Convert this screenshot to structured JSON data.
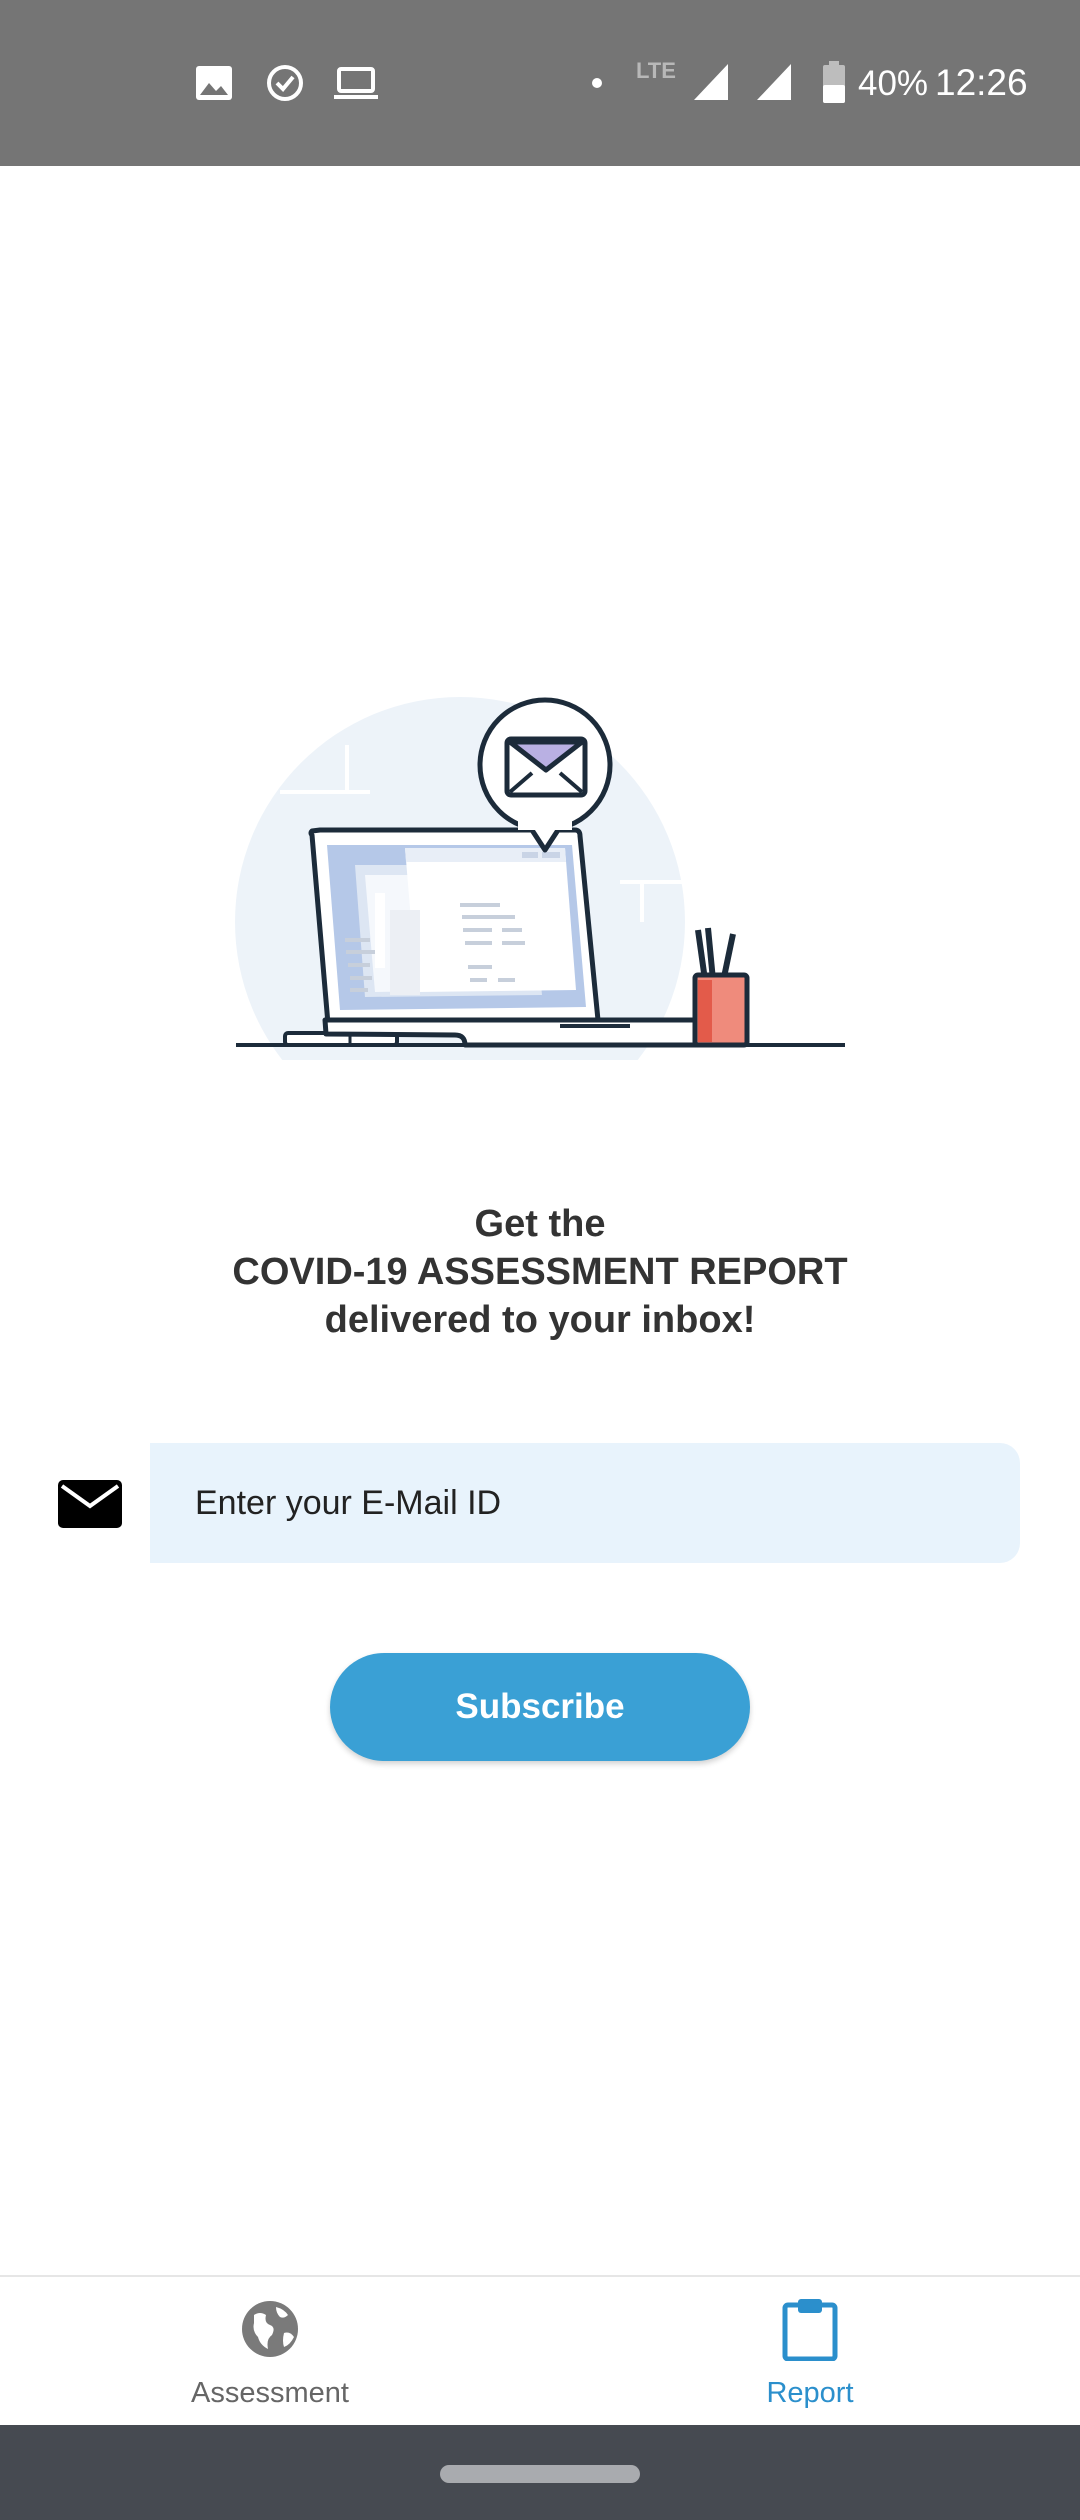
{
  "status_bar": {
    "network": "LTE",
    "battery": "40%",
    "time": "12:26",
    "notification_icons": [
      "image-icon",
      "clock-check-icon",
      "laptop-icon"
    ],
    "indicator_icons": [
      "dot-icon",
      "signal-icon",
      "signal-icon",
      "battery-icon"
    ]
  },
  "illustration": {
    "icons": [
      "laptop-icon",
      "envelope-bubble-icon",
      "pen-holder-icon"
    ]
  },
  "heading": {
    "line1": "Get the",
    "line2": "COVID-19 ASSESSMENT REPORT",
    "line3": "delivered to your inbox!"
  },
  "email": {
    "icon": "envelope-icon",
    "placeholder": "Enter your E-Mail ID",
    "value": ""
  },
  "subscribe": {
    "label": "Subscribe"
  },
  "bottom_nav": {
    "items": [
      {
        "label": "Assessment",
        "icon": "globe-icon",
        "active": false
      },
      {
        "label": "Report",
        "icon": "clipboard-icon",
        "active": true
      }
    ]
  },
  "colors": {
    "status_bar": "#757575",
    "accent": "#3aa0d5",
    "input_bg": "#e8f3fc",
    "active_nav": "#2b8fcc",
    "inactive_nav": "#666666",
    "system_nav": "#464a51"
  }
}
